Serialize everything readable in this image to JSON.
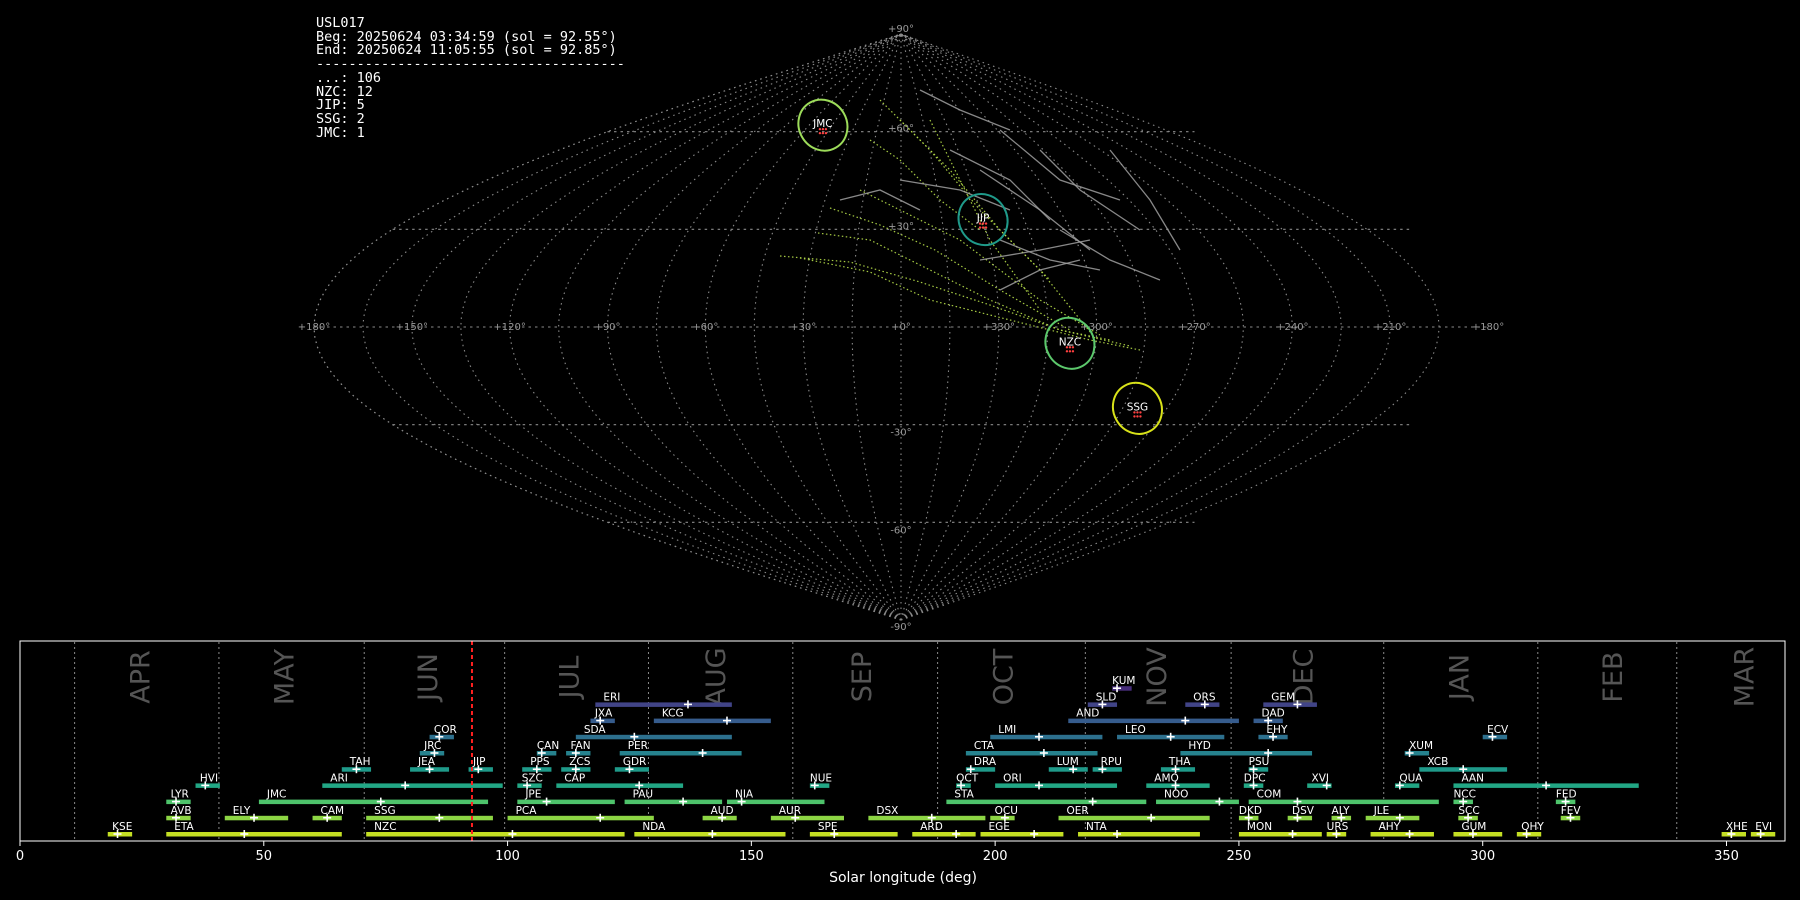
{
  "station": {
    "id": "USL017",
    "begin": "Beg: 20250624 03:34:59 (sol = 92.55°)",
    "end": "End: 20250624 11:05:55 (sol = 92.85°)",
    "rule": "--------------------------------------",
    "counts": [
      {
        "code": "...",
        "count": 106
      },
      {
        "code": "NZC",
        "count": 12
      },
      {
        "code": "JIP",
        "count": 5
      },
      {
        "code": "SSG",
        "count": 2
      },
      {
        "code": "JMC",
        "count": 1
      }
    ]
  },
  "chart_data": [
    {
      "type": "scatter",
      "projection": "sinusoidal all-sky",
      "grid": true,
      "lon_tick_labels": [
        "+180°",
        "+150°",
        "+120°",
        "+90°",
        "+60°",
        "+30°",
        "+0°",
        "+330°",
        "+300°",
        "+270°",
        "+240°",
        "+210°",
        "+180°"
      ],
      "lat_tick_labels": [
        "+90°",
        "+60°",
        "+30°",
        "-30°",
        "-60°",
        "-90°"
      ],
      "radiants": [
        {
          "code": "JMC",
          "lon": 51,
          "lat": 62,
          "color": "#9ddc5a"
        },
        {
          "code": "JIP",
          "lon": 330,
          "lat": 33,
          "color": "#1f9a8a"
        },
        {
          "code": "NZC",
          "lon": 308,
          "lat": -5,
          "color": "#5cc86c"
        },
        {
          "code": "SSG",
          "lon": 280,
          "lat": -25,
          "color": "#d8e219"
        }
      ]
    },
    {
      "type": "bar",
      "orientation": "horizontal",
      "xlabel": "Solar longitude (deg)",
      "xlim": [
        0,
        362
      ],
      "x_ticks": [
        0,
        50,
        100,
        150,
        200,
        250,
        300,
        350
      ],
      "current_sol": 92.7,
      "months": [
        {
          "label": "APR",
          "start": 11.2,
          "mid": 24.5
        },
        {
          "label": "MAY",
          "start": 40.8,
          "mid": 54.0
        },
        {
          "label": "JUN",
          "start": 70.6,
          "mid": 83.5
        },
        {
          "label": "JUL",
          "start": 99.4,
          "mid": 112.5
        },
        {
          "label": "AUG",
          "start": 128.9,
          "mid": 142.5
        },
        {
          "label": "SEP",
          "start": 158.5,
          "mid": 172.5
        },
        {
          "label": "OCT",
          "start": 188.2,
          "mid": 201.5
        },
        {
          "label": "NOV",
          "start": 218.5,
          "mid": 233.0
        },
        {
          "label": "DEC",
          "start": 248.4,
          "mid": 263.0
        },
        {
          "label": "JAN",
          "start": 279.7,
          "mid": 295.0
        },
        {
          "label": "FEB",
          "start": 311.3,
          "mid": 326.5
        },
        {
          "label": "MAR",
          "start": 339.8,
          "mid": 353.5
        }
      ],
      "showers": [
        {
          "code": "KUM",
          "start": 224.0,
          "end": 228.0,
          "peak": 225.0,
          "row": 10
        },
        {
          "code": "ERI",
          "start": 118.0,
          "end": 146.0,
          "peak": 137.0,
          "row": 9
        },
        {
          "code": "SLD",
          "start": 219.0,
          "end": 225.0,
          "peak": 222.0,
          "row": 9
        },
        {
          "code": "ORS",
          "start": 239.0,
          "end": 246.0,
          "peak": 243.0,
          "row": 9
        },
        {
          "code": "GEM",
          "start": 255.0,
          "end": 266.0,
          "peak": 262.0,
          "row": 9
        },
        {
          "code": "JXA",
          "start": 117.0,
          "end": 122.0,
          "peak": 119.0,
          "row": 8
        },
        {
          "code": "KCG",
          "start": 130.0,
          "end": 154.0,
          "peak": 145.0,
          "row": 8
        },
        {
          "code": "AND",
          "start": 215.0,
          "end": 250.0,
          "peak": 239.0,
          "row": 8
        },
        {
          "code": "DAD",
          "start": 253.0,
          "end": 259.0,
          "peak": 256.0,
          "row": 8
        },
        {
          "code": "COR",
          "start": 84.0,
          "end": 89.0,
          "peak": 86.0,
          "row": 7
        },
        {
          "code": "SDA",
          "start": 114.0,
          "end": 146.0,
          "peak": 126.0,
          "row": 7
        },
        {
          "code": "LMI",
          "start": 199.0,
          "end": 222.0,
          "peak": 209.0,
          "row": 7
        },
        {
          "code": "LEO",
          "start": 225.0,
          "end": 247.0,
          "peak": 236.0,
          "row": 7
        },
        {
          "code": "EHY",
          "start": 254.0,
          "end": 260.0,
          "peak": 257.0,
          "row": 7
        },
        {
          "code": "ECV",
          "start": 300.0,
          "end": 305.0,
          "peak": 302.0,
          "row": 7
        },
        {
          "code": "JRC",
          "start": 82.0,
          "end": 87.0,
          "peak": 85.0,
          "row": 6
        },
        {
          "code": "CAN",
          "start": 106.0,
          "end": 110.0,
          "peak": 107.0,
          "row": 6
        },
        {
          "code": "FAN",
          "start": 112.0,
          "end": 117.0,
          "peak": 114.0,
          "row": 6
        },
        {
          "code": "PER",
          "start": 123.0,
          "end": 148.0,
          "peak": 140.0,
          "row": 6
        },
        {
          "code": "CTA",
          "start": 194.0,
          "end": 221.0,
          "peak": 210.0,
          "row": 6
        },
        {
          "code": "HYD",
          "start": 238.0,
          "end": 265.0,
          "peak": 256.0,
          "row": 6
        },
        {
          "code": "XUM",
          "start": 284.0,
          "end": 289.0,
          "peak": 285.0,
          "row": 6
        },
        {
          "code": "TAH",
          "start": 66.0,
          "end": 72.0,
          "peak": 69.0,
          "row": 5
        },
        {
          "code": "JEA",
          "start": 80.0,
          "end": 88.0,
          "peak": 84.0,
          "row": 5
        },
        {
          "code": "JIP",
          "start": 92.0,
          "end": 97.0,
          "peak": 94.0,
          "row": 5
        },
        {
          "code": "PPS",
          "start": 103.0,
          "end": 109.0,
          "peak": 106.0,
          "row": 5
        },
        {
          "code": "ZCS",
          "start": 111.0,
          "end": 117.0,
          "peak": 114.0,
          "row": 5
        },
        {
          "code": "GDR",
          "start": 122.0,
          "end": 129.0,
          "peak": 125.0,
          "row": 5
        },
        {
          "code": "DRA",
          "start": 194.0,
          "end": 200.0,
          "peak": 195.0,
          "row": 5
        },
        {
          "code": "LUM",
          "start": 211.0,
          "end": 219.0,
          "peak": 216.0,
          "row": 5
        },
        {
          "code": "RPU",
          "start": 220.0,
          "end": 226.0,
          "peak": 222.0,
          "row": 5
        },
        {
          "code": "THA",
          "start": 234.0,
          "end": 241.0,
          "peak": 237.0,
          "row": 5
        },
        {
          "code": "PSU",
          "start": 252.0,
          "end": 256.0,
          "peak": 253.0,
          "row": 5
        },
        {
          "code": "XCB",
          "start": 287.0,
          "end": 305.0,
          "peak": 296.0,
          "row": 5
        },
        {
          "code": "HVI",
          "start": 36.0,
          "end": 41.0,
          "peak": 38.0,
          "row": 4
        },
        {
          "code": "ARI",
          "start": 62.0,
          "end": 99.0,
          "peak": 79.0,
          "row": 4
        },
        {
          "code": "SZC",
          "start": 102.0,
          "end": 107.0,
          "peak": 104.0,
          "row": 4
        },
        {
          "code": "CAP",
          "start": 110.0,
          "end": 136.0,
          "peak": 127.0,
          "row": 4
        },
        {
          "code": "NUE",
          "start": 162.0,
          "end": 166.0,
          "peak": 163.0,
          "row": 4
        },
        {
          "code": "OCT",
          "start": 192.0,
          "end": 195.0,
          "peak": 193.0,
          "row": 4
        },
        {
          "code": "ORI",
          "start": 200.0,
          "end": 225.0,
          "peak": 209.0,
          "row": 4
        },
        {
          "code": "AMO",
          "start": 231.0,
          "end": 244.0,
          "peak": 237.0,
          "row": 4
        },
        {
          "code": "DPC",
          "start": 251.0,
          "end": 255.0,
          "peak": 253.0,
          "row": 4
        },
        {
          "code": "XVI",
          "start": 264.0,
          "end": 269.0,
          "peak": 268.0,
          "row": 4
        },
        {
          "code": "QUA",
          "start": 282.0,
          "end": 287.0,
          "peak": 283.0,
          "row": 4
        },
        {
          "code": "AAN",
          "start": 294.0,
          "end": 332.0,
          "peak": 313.0,
          "row": 4
        },
        {
          "code": "LYR",
          "start": 30.0,
          "end": 35.0,
          "peak": 32.0,
          "row": 3
        },
        {
          "code": "JMC",
          "start": 49.0,
          "end": 96.0,
          "peak": 74.0,
          "row": 3
        },
        {
          "code": "JPE",
          "start": 102.0,
          "end": 122.0,
          "peak": 108.0,
          "row": 3
        },
        {
          "code": "PAU",
          "start": 124.0,
          "end": 144.0,
          "peak": 136.0,
          "row": 3
        },
        {
          "code": "NIA",
          "start": 145.0,
          "end": 165.0,
          "peak": 148.0,
          "row": 3
        },
        {
          "code": "STA",
          "start": 190.0,
          "end": 231.0,
          "peak": 220.0,
          "row": 3
        },
        {
          "code": "NOO",
          "start": 233.0,
          "end": 250.0,
          "peak": 246.0,
          "row": 3
        },
        {
          "code": "COM",
          "start": 252.0,
          "end": 291.0,
          "peak": 262.0,
          "row": 3
        },
        {
          "code": "NCC",
          "start": 294.0,
          "end": 298.0,
          "peak": 296.0,
          "row": 3
        },
        {
          "code": "FED",
          "start": 315.0,
          "end": 319.0,
          "peak": 317.0,
          "row": 3
        },
        {
          "code": "AVB",
          "start": 30.0,
          "end": 35.0,
          "peak": 32.0,
          "row": 2
        },
        {
          "code": "ELY",
          "start": 42.0,
          "end": 55.0,
          "peak": 48.0,
          "row": 2
        },
        {
          "code": "CAM",
          "start": 60.0,
          "end": 66.0,
          "peak": 63.0,
          "row": 2
        },
        {
          "code": "SSG",
          "start": 71.0,
          "end": 97.0,
          "peak": 86.0,
          "row": 2
        },
        {
          "code": "PCA",
          "start": 100.0,
          "end": 130.0,
          "peak": 119.0,
          "row": 2
        },
        {
          "code": "AUD",
          "start": 140.0,
          "end": 147.0,
          "peak": 144.0,
          "row": 2
        },
        {
          "code": "AUR",
          "start": 154.0,
          "end": 169.0,
          "peak": 159.0,
          "row": 2
        },
        {
          "code": "DSX",
          "start": 174.0,
          "end": 198.0,
          "peak": 187.0,
          "row": 2
        },
        {
          "code": "OCU",
          "start": 199.0,
          "end": 204.0,
          "peak": 202.0,
          "row": 2
        },
        {
          "code": "OER",
          "start": 213.0,
          "end": 244.0,
          "peak": 232.0,
          "row": 2
        },
        {
          "code": "DKD",
          "start": 250.0,
          "end": 254.0,
          "peak": 252.0,
          "row": 2
        },
        {
          "code": "DSV",
          "start": 260.0,
          "end": 265.0,
          "peak": 262.0,
          "row": 2
        },
        {
          "code": "ALY",
          "start": 269.0,
          "end": 273.0,
          "peak": 271.0,
          "row": 2
        },
        {
          "code": "JLE",
          "start": 276.0,
          "end": 287.0,
          "peak": 283.0,
          "row": 2
        },
        {
          "code": "SCC",
          "start": 295.0,
          "end": 299.0,
          "peak": 297.0,
          "row": 2
        },
        {
          "code": "FEV",
          "start": 316.0,
          "end": 320.0,
          "peak": 318.0,
          "row": 2
        },
        {
          "code": "KSE",
          "start": 18.0,
          "end": 23.0,
          "peak": 20.0,
          "row": 1
        },
        {
          "code": "ETA",
          "start": 30.0,
          "end": 66.0,
          "peak": 46.0,
          "row": 1
        },
        {
          "code": "NZC",
          "start": 71.0,
          "end": 124.0,
          "peak": 101.0,
          "row": 1
        },
        {
          "code": "NDA",
          "start": 126.0,
          "end": 157.0,
          "peak": 142.0,
          "row": 1
        },
        {
          "code": "SPE",
          "start": 162.0,
          "end": 180.0,
          "peak": 167.0,
          "row": 1
        },
        {
          "code": "ARD",
          "start": 183.0,
          "end": 196.0,
          "peak": 192.0,
          "row": 1
        },
        {
          "code": "EGE",
          "start": 197.0,
          "end": 214.0,
          "peak": 208.0,
          "row": 1
        },
        {
          "code": "NTA",
          "start": 217.0,
          "end": 242.0,
          "peak": 225.0,
          "row": 1
        },
        {
          "code": "MON",
          "start": 250.0,
          "end": 267.0,
          "peak": 261.0,
          "row": 1
        },
        {
          "code": "URS",
          "start": 268.0,
          "end": 272.0,
          "peak": 270.0,
          "row": 1
        },
        {
          "code": "AHY",
          "start": 277.0,
          "end": 290.0,
          "peak": 285.0,
          "row": 1
        },
        {
          "code": "GUM",
          "start": 294.0,
          "end": 304.0,
          "peak": 298.0,
          "row": 1
        },
        {
          "code": "OHY",
          "start": 307.0,
          "end": 312.0,
          "peak": 309.0,
          "row": 1
        },
        {
          "code": "XHE",
          "start": 349.0,
          "end": 354.0,
          "peak": 351.0,
          "row": 1
        },
        {
          "code": "EVI",
          "start": 355.0,
          "end": 360.0,
          "peak": 357.0,
          "row": 1
        }
      ]
    }
  ]
}
